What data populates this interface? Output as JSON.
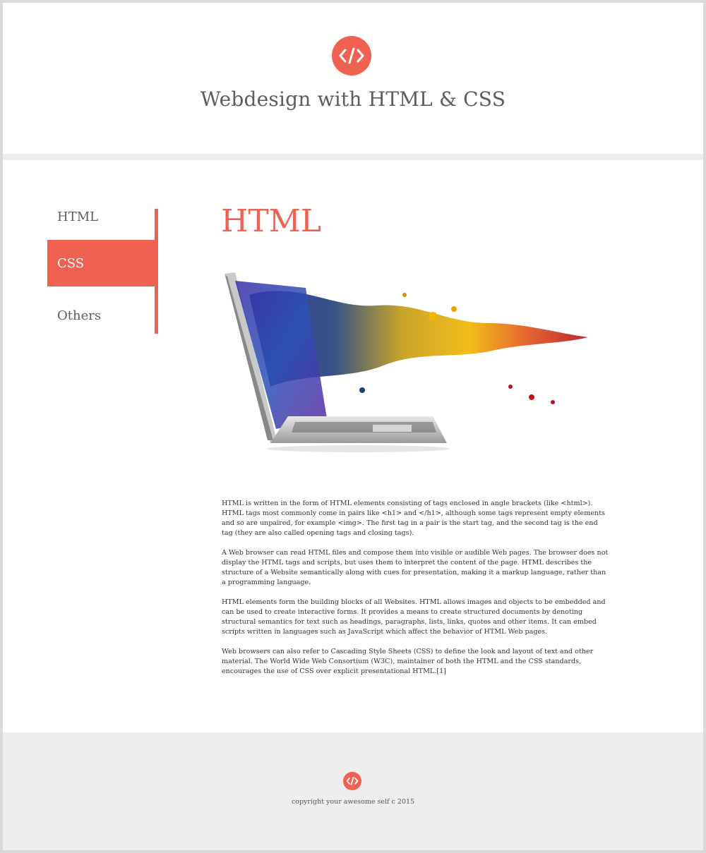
{
  "site": {
    "title": "Webdesign with HTML & CSS",
    "accent_color": "#ef6150",
    "logo_icon": "code-icon"
  },
  "nav": {
    "items": [
      {
        "label": "HTML",
        "active": false
      },
      {
        "label": "CSS",
        "active": true
      },
      {
        "label": "Others",
        "active": false
      }
    ]
  },
  "main": {
    "heading": "HTML",
    "hero_image": "laptop-paint-splash-image",
    "paragraphs": [
      "HTML is written in the form of HTML elements consisting of tags enclosed in angle brackets (like <html>). HTML tags most commonly come in pairs like <h1> and </h1>, although some tags represent empty elements and so are unpaired, for example <img>. The first tag in a pair is the start tag, and the second tag is the end tag (they are also called opening tags and closing tags).",
      "A Web browser can read HTML files and compose them into visible or audible Web pages. The browser does not display the HTML tags and scripts, but uses them to interpret the content of the page. HTML describes the structure of a Website semantically along with cues for presentation, making it a markup language, rather than a programming language.",
      "HTML elements form the building blocks of all Websites. HTML allows images and objects to be embedded and can be used to create interactive forms. It provides a means to create structured documents by denoting structural semantics for text such as headings, paragraphs, lists, links, quotes and other items. It can embed scripts written in languages such as JavaScript which affect the behavior of HTML Web pages.",
      "Web browsers can also refer to Cascading Style Sheets (CSS) to define the look and layout of text and other material. The World Wide Web Consortium (W3C), maintainer of both the HTML and the CSS standards, encourages the use of CSS over explicit presentational HTML.[1]"
    ]
  },
  "footer": {
    "logo_icon": "code-icon",
    "copyright": "copyright your awesome self c 2015"
  }
}
